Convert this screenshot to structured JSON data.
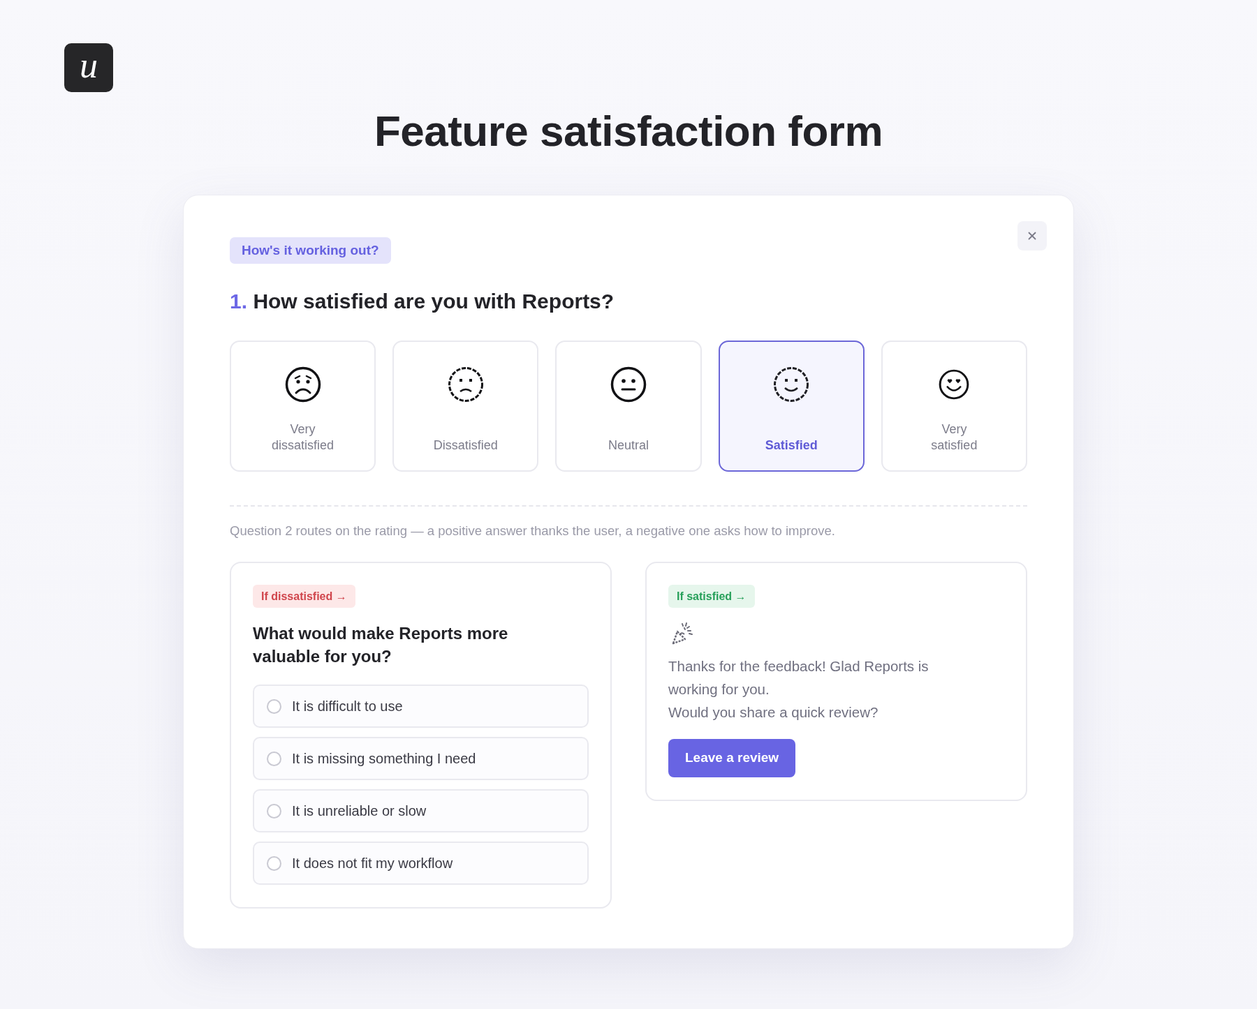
{
  "logo": "u",
  "page_title": "Feature satisfaction form",
  "survey": {
    "badge": "How's it working out?",
    "question": {
      "number": "1.",
      "text": "How satisfied are you with Reports?"
    },
    "ratings": [
      {
        "label": "Very dissatisfied",
        "selected": false
      },
      {
        "label": "Dissatisfied",
        "selected": false
      },
      {
        "label": "Neutral",
        "selected": false
      },
      {
        "label": "Satisfied",
        "selected": true
      },
      {
        "label": "Very satisfied",
        "selected": false
      }
    ],
    "routing_note": "Question 2 routes on the rating — a positive answer thanks the user, a negative one asks how to improve.",
    "if_dissatisfied": {
      "badge": "If dissatisfied →",
      "question": "What would make Reports more valuable for you?",
      "options": [
        {
          "label": "It is difficult to use",
          "selected": false
        },
        {
          "label": "It is missing something I need",
          "selected": false
        },
        {
          "label": "It is unreliable or slow",
          "selected": false
        },
        {
          "label": "It does not fit my workflow",
          "selected": false
        }
      ]
    },
    "if_satisfied": {
      "badge": "If satisfied →",
      "message": "Thanks for the feedback! Glad Reports is working for you.",
      "prompt": "Would you share a quick review?",
      "button": "Leave a review"
    }
  }
}
